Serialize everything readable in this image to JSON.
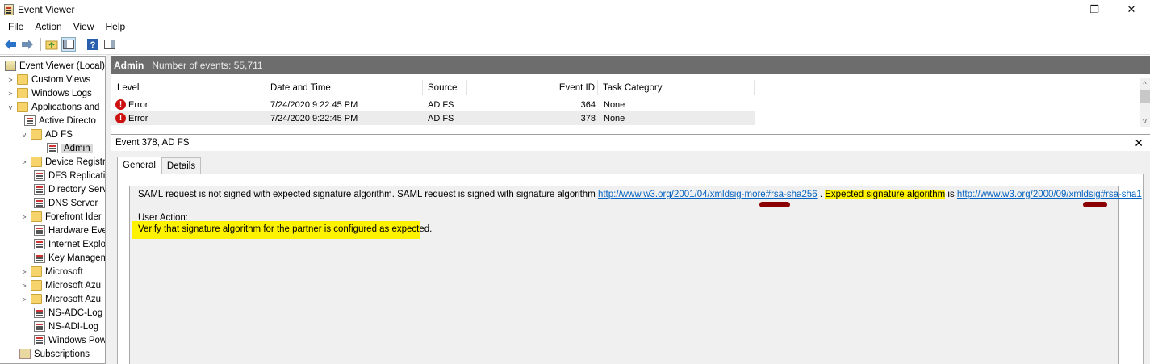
{
  "window": {
    "title": "Event Viewer",
    "minimize": "—",
    "restore": "❐",
    "close": "✕"
  },
  "menu": [
    "File",
    "Action",
    "View",
    "Help"
  ],
  "tree": {
    "root": "Event Viewer (Local)",
    "custom_views": "Custom Views",
    "windows_logs": "Windows Logs",
    "apps_and": "Applications and",
    "active_directory": "Active Directo",
    "adfs": "AD FS",
    "admin": "Admin",
    "device_registr": "Device Registr",
    "dfs_replicati": "DFS Replicatic",
    "directory_serv": "Directory Serv",
    "dns_server": "DNS Server",
    "forefront": "Forefront Ider",
    "hardware": "Hardware Eve",
    "internet_explo": "Internet Explo",
    "key_manager": "Key Managem",
    "microsoft": "Microsoft",
    "ms_azure1": "Microsoft Azu",
    "ms_azure2": "Microsoft Azu",
    "ns_adc": "NS-ADC-Log",
    "ns_adi": "NS-ADI-Log",
    "windows_pow": "Windows Pow",
    "subscriptions": "Subscriptions"
  },
  "pane": {
    "name": "Admin",
    "count": "Number of events: 55,711"
  },
  "table": {
    "columns": [
      "Level",
      "Date and Time",
      "Source",
      "Event ID",
      "Task Category"
    ],
    "rows": [
      {
        "level": "Error",
        "datetime": "7/24/2020 9:22:45 PM",
        "source": "AD FS",
        "event_id": "364",
        "task": "None"
      },
      {
        "level": "Error",
        "datetime": "7/24/2020 9:22:45 PM",
        "source": "AD FS",
        "event_id": "378",
        "task": "None"
      }
    ]
  },
  "details": {
    "header": "Event 378, AD FS",
    "tabs": [
      "General",
      "Details"
    ],
    "msg_part1": "SAML request is not signed with expected signature algorithm. SAML request is signed with signature algorithm ",
    "link1": "http://www.w3.org/2001/04/xmldsig-more#rsa-sha256",
    "msg_part2": " . ",
    "msg_expected": "Expected signature algorithm",
    "msg_is": " is ",
    "link2": "http://www.w3.org/2000/09/xmldsig#rsa-sha1",
    "user_action_label": "User Action:",
    "user_action_text": "Verify that signature algorithm for the partner is configured as expected."
  },
  "colors": {
    "highlight": "#fff200",
    "redaction": "#8b0000",
    "link": "#0563c1",
    "header_bg": "#6d6d6d",
    "error": "#cc1111"
  }
}
